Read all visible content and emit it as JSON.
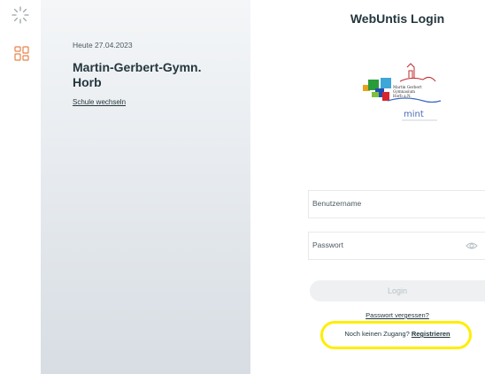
{
  "sidebar": {
    "icons": [
      "loading-icon",
      "grid-icon"
    ]
  },
  "panel": {
    "date": "Heute 27.04.2023",
    "school_name": "Martin-Gerbert-Gymn. Horb",
    "switch_school": "Schule wechseln"
  },
  "login": {
    "title": "WebUntis Login",
    "logo_lines": [
      "Martin Gerbert",
      "Gymnasium",
      "Horb a.N."
    ],
    "logo_mint": "mint",
    "username_label": "Benutzername",
    "password_label": "Passwort",
    "login_button": "Login",
    "forgot_password": "Passwort vergessen?",
    "no_access": "Noch keinen Zugang?",
    "register": "Registrieren"
  },
  "colors": {
    "text": "#24373e",
    "rail_icon": "#e7834a",
    "highlight": "#ffee00"
  }
}
